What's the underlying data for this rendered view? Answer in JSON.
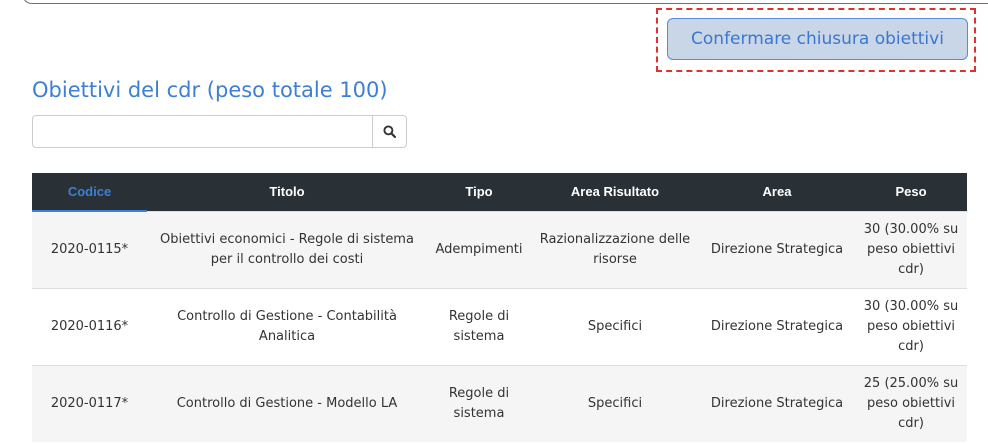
{
  "actions": {
    "confirm_label": "Confermare chiusura obiettivi"
  },
  "section": {
    "title": "Obiettivi del cdr (peso totale 100)"
  },
  "search": {
    "value": "",
    "placeholder": ""
  },
  "table": {
    "headers": [
      "Codice",
      "Titolo",
      "Tipo",
      "Area Risultato",
      "Area",
      "Peso"
    ],
    "sorted_column": "Codice",
    "rows": [
      {
        "codice": "2020-0115*",
        "titolo": "Obiettivi economici - Regole di sistema per il controllo dei costi",
        "tipo": "Adempimenti",
        "area_risultato": "Razionalizzazione delle risorse",
        "area": "Direzione Strategica",
        "peso": "30 (30.00% su peso obiettivi cdr)"
      },
      {
        "codice": "2020-0116*",
        "titolo": "Controllo di Gestione - Contabilità Analitica",
        "tipo": "Regole di sistema",
        "area_risultato": "Specifici",
        "area": "Direzione Strategica",
        "peso": "30 (30.00% su peso obiettivi cdr)"
      },
      {
        "codice": "2020-0117*",
        "titolo": "Controllo di Gestione - Modello LA",
        "tipo": "Regole di sistema",
        "area_risultato": "Specifici",
        "area": "Direzione Strategica",
        "peso": "25 (25.00% su peso obiettivi cdr)"
      }
    ]
  },
  "colors": {
    "accent": "#3d7fd6",
    "header_bg": "#2a3136",
    "button_bg": "#c8d6e8",
    "highlight": "#e03131"
  },
  "icons": {
    "search": "search-icon"
  }
}
